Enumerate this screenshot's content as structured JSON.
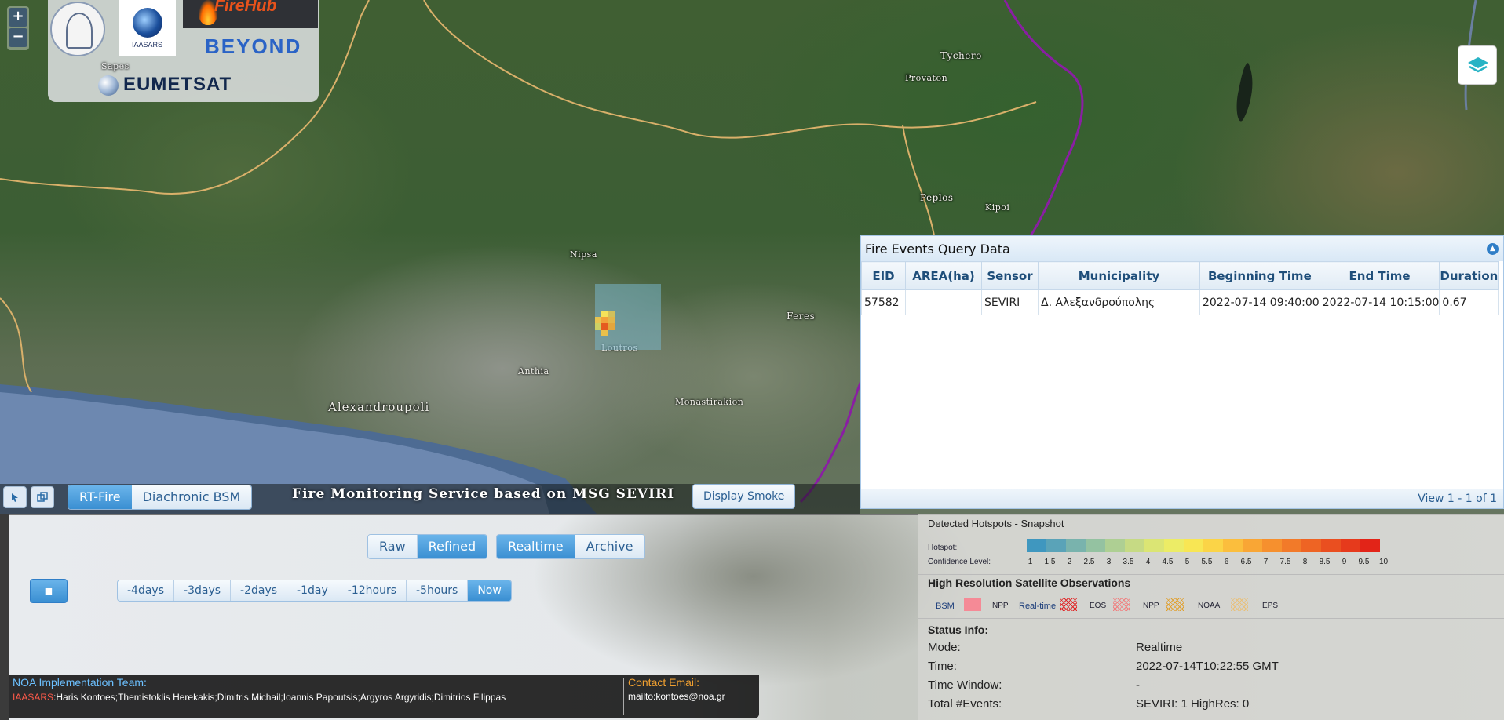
{
  "map": {
    "zoom_in": "+",
    "zoom_out": "−",
    "places": {
      "tychero": "Tychero",
      "provaton": "Provaton",
      "peplos": "Peplos",
      "kipoi": "Kipoi",
      "nipsa": "Nipsa",
      "feres": "Feres",
      "loutros": "Loutros",
      "anthia": "Anthia",
      "alexandroupoli": "Alexandroupoli",
      "monastirakion": "Monastirakion",
      "sapes": "Sapes"
    },
    "logos": {
      "iaasars": "IAASARS",
      "firehub": "FireHub",
      "beyond": "BEYOND",
      "eumetsat": "EUMETSAT"
    },
    "bar": {
      "rt_fire": "RT-Fire",
      "diachronic_bsm": "Diachronic BSM",
      "service_title": "Fire Monitoring Service based on MSG SEVIRI",
      "display_smoke": "Display Smoke"
    }
  },
  "fire_events": {
    "title": "Fire Events Query Data",
    "columns": [
      "EID",
      "AREA(ha)",
      "Sensor",
      "Municipality",
      "Beginning Time",
      "End Time",
      "Duration"
    ],
    "rows": [
      [
        "57582",
        "",
        "SEVIRI",
        "Δ. Αλεξανδρούπολης",
        "2022-07-14 09:40:00",
        "2022-07-14 10:15:00",
        "0.67"
      ]
    ],
    "footer": "View 1 - 1 of 1"
  },
  "controls": {
    "mode_toggle": [
      "Raw",
      "Refined"
    ],
    "time_toggle": [
      "Realtime",
      "Archive"
    ],
    "stop": "■",
    "windows": [
      "-4days",
      "-3days",
      "-2days",
      "-1day",
      "-12hours",
      "-5hours",
      "Now"
    ]
  },
  "credits": {
    "team_label": "NOA Implementation Team:",
    "org": "IAASARS",
    "members": ":Haris Kontoes;Themistoklis Herekakis;Dimitris Michail;Ioannis Papoutsis;Argyros Argyridis;Dimitrios Filippas",
    "contact_label": "Contact Email:",
    "contact": "mailto:kontoes@noa.gr"
  },
  "legend": {
    "hotspots_title": "Detected Hotspots - Snapshot",
    "hotspot_label": "Hotspot:",
    "confidence_label": "Confidence Level:",
    "confidence_values": [
      "1",
      "1.5",
      "2",
      "2.5",
      "3",
      "3.5",
      "4",
      "4.5",
      "5",
      "5.5",
      "6",
      "6.5",
      "7",
      "7.5",
      "8",
      "8.5",
      "9",
      "9.5",
      "10"
    ],
    "confidence_colors": [
      "#3f97bf",
      "#5aa3b8",
      "#79b3ad",
      "#94c2a1",
      "#aecf93",
      "#c6da84",
      "#dbe574",
      "#ecec66",
      "#f8e654",
      "#fbd447",
      "#fbbe3d",
      "#f9a635",
      "#f6902e",
      "#f27a29",
      "#ee6424",
      "#ea4f20",
      "#e63a1c",
      "#e22418"
    ],
    "hires_title": "High Resolution Satellite Observations",
    "bsm": "BSM",
    "npp": "NPP",
    "realtime": "Real-time",
    "eos": "EOS",
    "npp2": "NPP",
    "noaa": "NOAA",
    "eps": "EPS",
    "bsm_color": "#f58a96",
    "status_title": "Status Info:",
    "status": [
      {
        "k": "Mode:",
        "v": "Realtime"
      },
      {
        "k": "Time:",
        "v": "2022-07-14T10:22:55 GMT"
      },
      {
        "k": "Time Window:",
        "v": "-"
      },
      {
        "k": "Total #Events:",
        "v": "SEVIRI: 1  HighRes: 0"
      }
    ]
  }
}
